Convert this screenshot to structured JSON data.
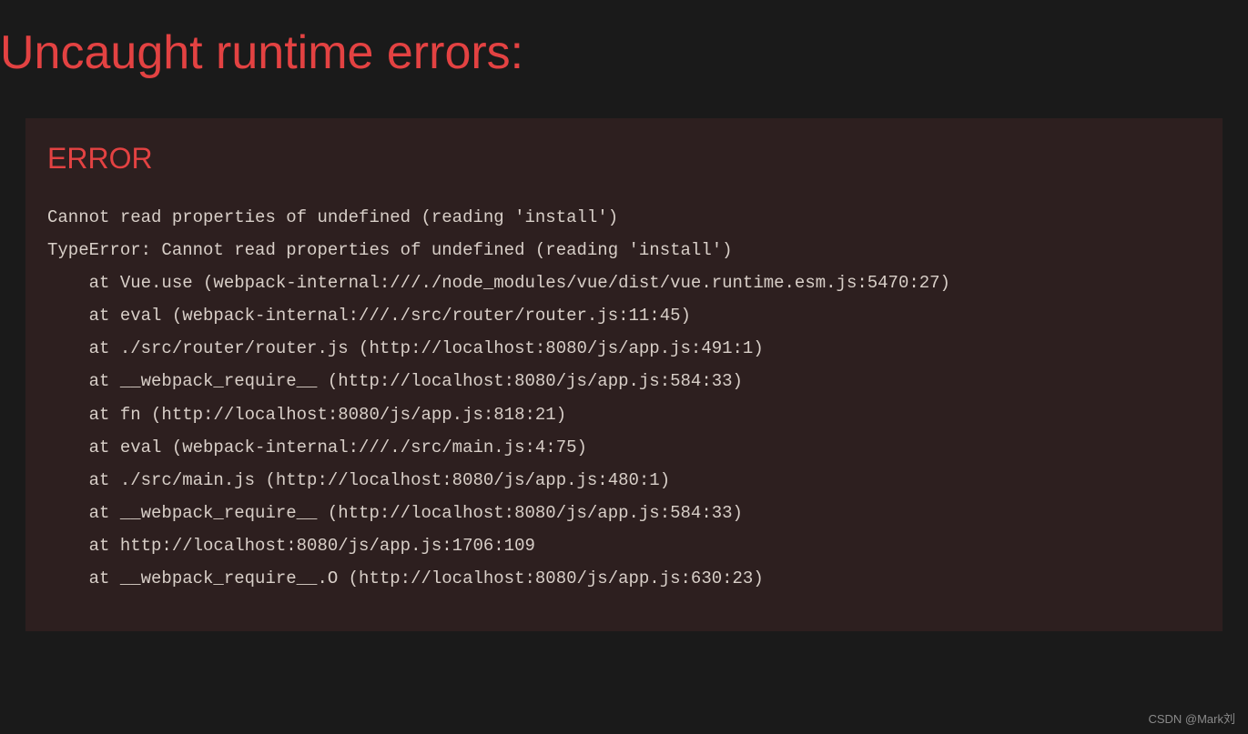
{
  "page": {
    "title": "Uncaught runtime errors:"
  },
  "error": {
    "label": "ERROR",
    "summary": "Cannot read properties of undefined (reading 'install')",
    "stack": [
      "TypeError: Cannot read properties of undefined (reading 'install')",
      "    at Vue.use (webpack-internal:///./node_modules/vue/dist/vue.runtime.esm.js:5470:27)",
      "    at eval (webpack-internal:///./src/router/router.js:11:45)",
      "    at ./src/router/router.js (http://localhost:8080/js/app.js:491:1)",
      "    at __webpack_require__ (http://localhost:8080/js/app.js:584:33)",
      "    at fn (http://localhost:8080/js/app.js:818:21)",
      "    at eval (webpack-internal:///./src/main.js:4:75)",
      "    at ./src/main.js (http://localhost:8080/js/app.js:480:1)",
      "    at __webpack_require__ (http://localhost:8080/js/app.js:584:33)",
      "    at http://localhost:8080/js/app.js:1706:109",
      "    at __webpack_require__.O (http://localhost:8080/js/app.js:630:23)"
    ]
  },
  "watermark": "CSDN @Mark刘"
}
